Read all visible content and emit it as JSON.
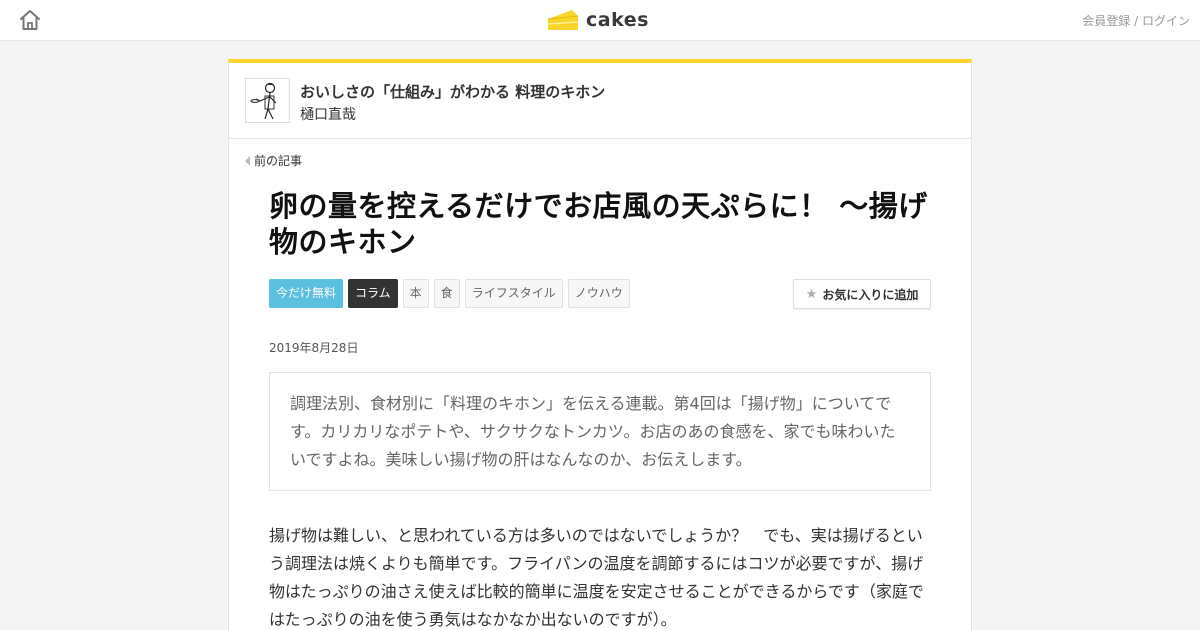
{
  "header": {
    "logo_text": "cakes",
    "auth": {
      "register_label": "会員登録",
      "separator": " / ",
      "login_label": "ログイン"
    },
    "brand_color": "#f7d52a"
  },
  "series": {
    "title": "おいしさの「仕組み」がわかる 料理のキホン",
    "author": "樋口直哉"
  },
  "nav": {
    "prev_label": "前の記事"
  },
  "article": {
    "title": "卵の量を控えるだけでお店風の天ぷらに！ 〜揚げ物のキホン",
    "tags": [
      {
        "label": "今だけ無料",
        "style": "free"
      },
      {
        "label": "コラム",
        "style": "column"
      },
      {
        "label": "本",
        "style": "plain"
      },
      {
        "label": "食",
        "style": "plain"
      },
      {
        "label": "ライフスタイル",
        "style": "plain"
      },
      {
        "label": "ノウハウ",
        "style": "plain"
      }
    ],
    "favorite_label": "お気に入りに追加",
    "date": "2019年8月28日",
    "lead": "調理法別、食材別に「料理のキホン」を伝える連載。第4回は「揚げ物」についてです。カリカリなポテトや、サクサクなトンカツ。お店のあの食感を、家でも味わいたいですよね。美味しい揚げ物の肝はなんなのか、お伝えします。",
    "body": "揚げ物は難しい、と思われている方は多いのではないでしょうか？　でも、実は揚げるという調理法は焼くよりも簡単です。フライパンの温度を調節するにはコツが必要ですが、揚げ物はたっぷりの油さえ使えば比較的簡単に温度を安定させることができるからです（家庭ではたっぷりの油を使う勇気はなかなか出ないのですが）。"
  }
}
